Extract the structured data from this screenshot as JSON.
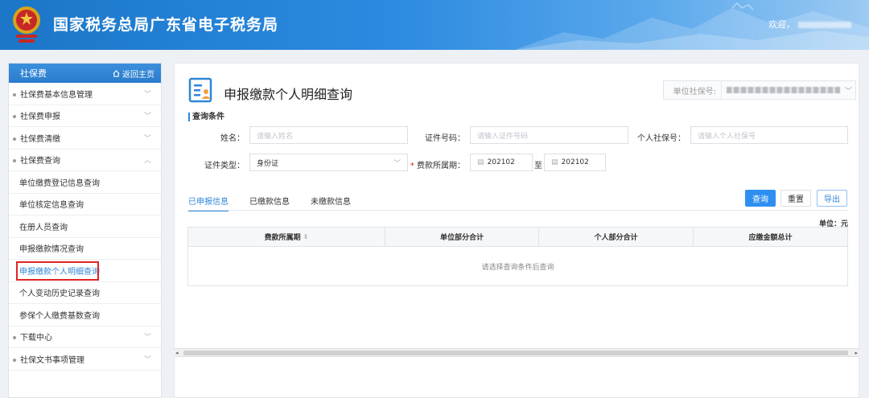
{
  "header": {
    "site_title": "国家税务总局广东省电子税务局",
    "welcome_text": "欢迎，",
    "colors": {
      "header_start": "#1b76c8",
      "header_end": "#9ccaf3"
    }
  },
  "sidebar": {
    "title": "社保费",
    "home_label": "返回主页",
    "menu": [
      {
        "label": "社保费基本信息管理"
      },
      {
        "label": "社保费申报"
      },
      {
        "label": "社保费清缴"
      },
      {
        "label": "社保费查询"
      }
    ],
    "submenu": [
      {
        "label": "单位缴费登记信息查询"
      },
      {
        "label": "单位核定信息查询"
      },
      {
        "label": "在册人员查询"
      },
      {
        "label": "申报缴款情况查询"
      },
      {
        "label": "申报缴款个人明细查询"
      },
      {
        "label": "个人变动历史记录查询"
      },
      {
        "label": "参保个人缴费基数查询"
      }
    ],
    "menu_after": [
      {
        "label": "下载中心"
      },
      {
        "label": "社保文书事项管理"
      }
    ]
  },
  "page": {
    "title": "申报缴款个人明细查询",
    "unit_ss_label": "单位社保号:",
    "section_label": "查询条件"
  },
  "form": {
    "name_label": "姓名：",
    "name_placeholder": "请输入姓名",
    "idno_label": "证件号码：",
    "idno_placeholder": "请输入证件号码",
    "pss_label": "个人社保号：",
    "pss_placeholder": "请输入个人社保号",
    "idtype_label": "证件类型：",
    "idtype_value": "身份证",
    "period_required_mark": "*",
    "period_label": "费款所属期：",
    "period_start": "202102",
    "period_to": "至",
    "period_end": "202102"
  },
  "tabs": [
    "已申报信息",
    "已缴款信息",
    "未缴款信息"
  ],
  "buttons": {
    "query": "查询",
    "reset": "重置",
    "export": "导出"
  },
  "table": {
    "unit_note": "单位：元",
    "columns": [
      "费款所属期",
      "单位部分合计",
      "个人部分合计",
      "应缴金额总计"
    ],
    "empty_text": "请选择查询条件后查询"
  },
  "accent_color": "#2f86d6"
}
